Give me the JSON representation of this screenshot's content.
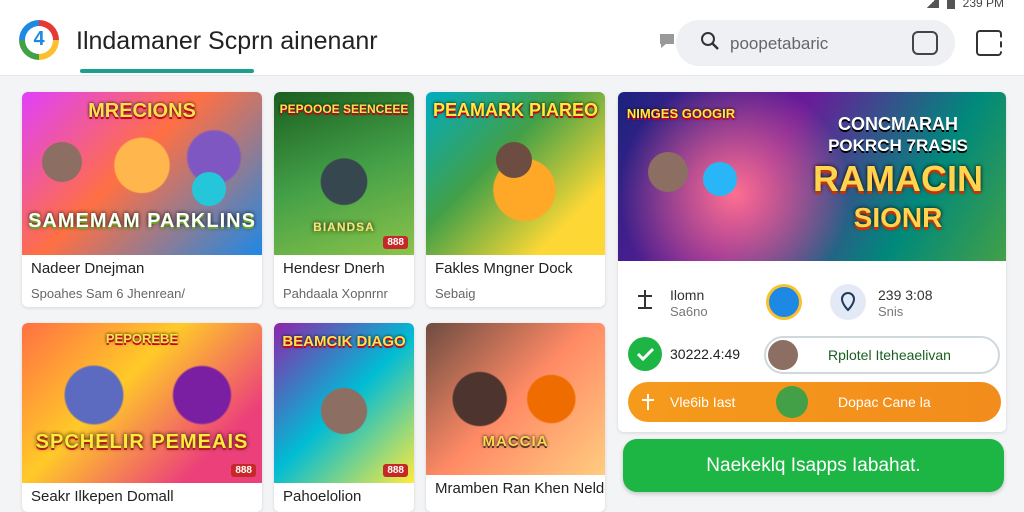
{
  "status_bar": {
    "time": "239 PM"
  },
  "header": {
    "logo_glyph": "4",
    "title": "Ilndamaner Scprn ainenanr",
    "search_placeholder": "poopetabaric",
    "colors": {
      "accent": "#1aa08f",
      "cta": "#1db644",
      "orange": "#f28c1c"
    }
  },
  "games": [
    {
      "title": "Nadeer Dnejman",
      "subtitle": "Spoahes Sam 6 Jhenrean/",
      "art_top": "MRECIONS",
      "art_bottom": "SAMEMAM PARKLINS",
      "badge": ""
    },
    {
      "title": "Hendesr Dnerh",
      "subtitle": "Pahdaala Xopnrnr",
      "art_top": "PEPOOOE SEENCEEE",
      "art_bottom": "BIANDSA",
      "badge": "888"
    },
    {
      "title": "Fakles Mngner Dock",
      "subtitle": "Sebaig",
      "art_top": "PEAMARK PIAREO",
      "art_bottom": "",
      "badge": ""
    },
    {
      "title": "Seakr Ilkepen Domall",
      "subtitle": "",
      "art_top": "PEPOREBE",
      "art_bottom": "SPCHELIR PEMEAIS",
      "badge": "888"
    },
    {
      "title": "Pahoelolion",
      "subtitle": "",
      "art_top": "BEAMCIK DIAGO",
      "art_bottom": "",
      "badge": "888"
    },
    {
      "title": "Mramben Ran Khen Nelder",
      "subtitle": "",
      "art_top": "",
      "art_bottom": "MACCIA",
      "badge": ""
    }
  ],
  "feature": {
    "art_line1": "CONCMARAH",
    "art_line2": "POKRCH 7RASIS",
    "art_line3": "RAMACIN",
    "art_line4": "SIONR",
    "art_top_left": "NIMGES GOOGIR",
    "info": {
      "left_label": "Ilomn",
      "left_sub": "Sa6no",
      "right_label": "239 3:08",
      "right_sub": "Snis"
    },
    "green_row": {
      "number": "30222.4:49",
      "label": "Rplotel Iteheaelivan"
    },
    "orange_row": {
      "label": "Vle6ib Iast",
      "action": "Dopac Cane la"
    }
  },
  "cta": {
    "label": "Naekeklq Isapps Iabahat."
  }
}
